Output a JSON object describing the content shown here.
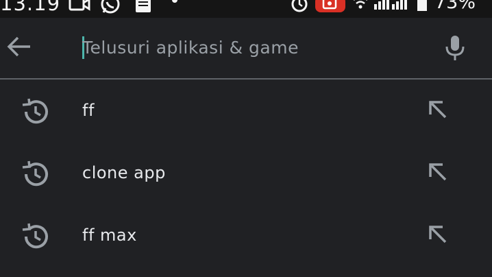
{
  "status_bar": {
    "time": "13.19",
    "battery": "73%",
    "icons": [
      "video-call-icon",
      "whatsapp-icon",
      "document-icon",
      "dot-icon",
      "alarm-icon",
      "screen-record-icon",
      "wifi-icon",
      "signal-icon",
      "signal-icon",
      "battery-icon"
    ]
  },
  "search": {
    "placeholder": "Telusuri aplikasi & game",
    "back_icon": "arrow-left-icon",
    "mic_icon": "microphone-icon"
  },
  "history": {
    "items": [
      {
        "label": "ff"
      },
      {
        "label": "clone app"
      },
      {
        "label": "ff max"
      }
    ],
    "item_icon": "history-icon",
    "action_icon": "arrow-up-left-icon"
  },
  "colors": {
    "background": "#202124",
    "accent_cursor": "#4db6ac",
    "record_badge": "#d93025",
    "text": "#e8eaed",
    "muted": "#9aa0a6"
  }
}
